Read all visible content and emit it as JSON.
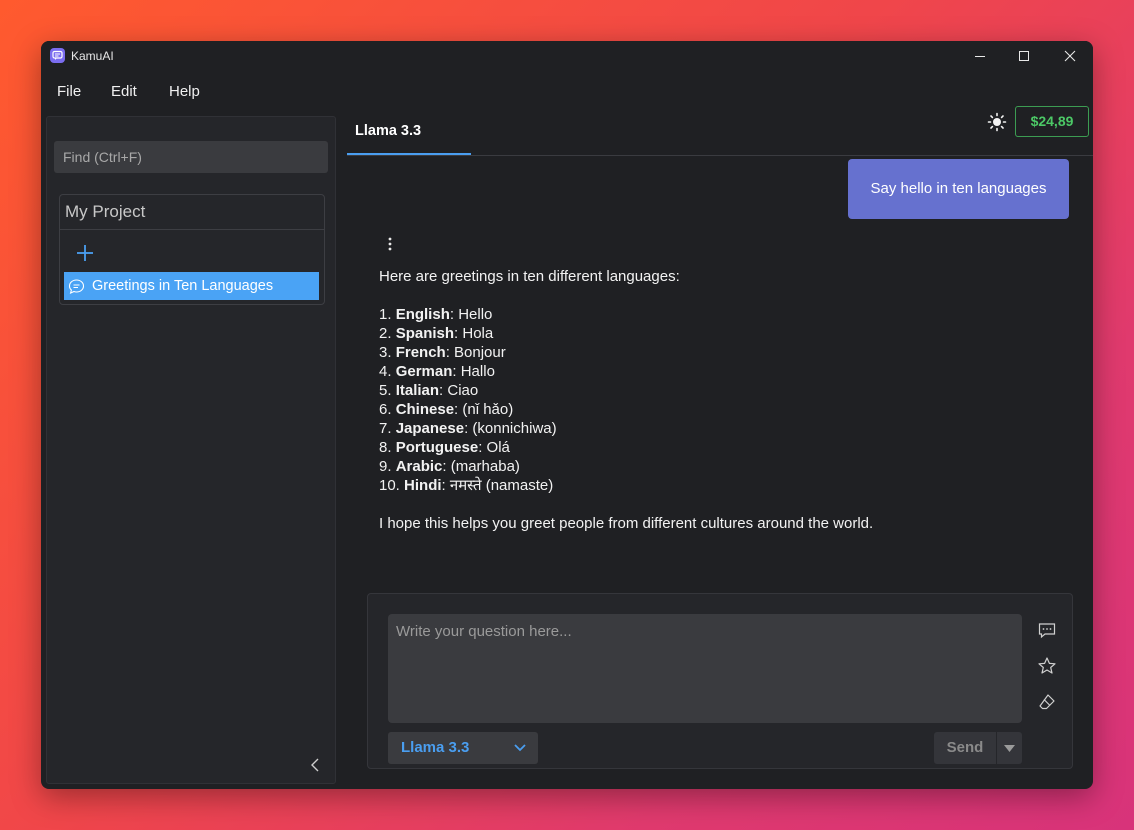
{
  "window": {
    "title": "KamuAI"
  },
  "menu": {
    "items": [
      "File",
      "Edit",
      "Help"
    ]
  },
  "header": {
    "balance": "$24,89",
    "balance_color": "#4cc866"
  },
  "sidebar": {
    "search_placeholder": "Find (Ctrl+F)",
    "project_title": "My Project",
    "chats": [
      {
        "label": "Greetings in Ten Languages",
        "selected": true
      }
    ]
  },
  "tabs": [
    {
      "label": "Llama 3.3",
      "active": true
    }
  ],
  "conversation": {
    "user_message": "Say hello in ten languages",
    "reply_intro": "Here are greetings in ten different languages:",
    "reply_items": [
      {
        "num": "1.",
        "lang": "English",
        "text": ": Hello"
      },
      {
        "num": "2.",
        "lang": "Spanish",
        "text": ": Hola"
      },
      {
        "num": "3.",
        "lang": "French",
        "text": ": Bonjour"
      },
      {
        "num": "4.",
        "lang": "German",
        "text": ": Hallo"
      },
      {
        "num": "5.",
        "lang": "Italian",
        "text": ": Ciao"
      },
      {
        "num": "6.",
        "lang": "Chinese",
        "text": ": (nǐ hǎo)"
      },
      {
        "num": "7.",
        "lang": "Japanese",
        "text": ": (konnichiwa)"
      },
      {
        "num": "8.",
        "lang": "Portuguese",
        "text": ": Olá"
      },
      {
        "num": "9.",
        "lang": "Arabic",
        "text": ": (marhaba)"
      },
      {
        "num": "10.",
        "lang": "Hindi",
        "text": ": नमस्ते (namaste)"
      }
    ],
    "reply_outro": "I hope this helps you greet people from different cultures around the world."
  },
  "composer": {
    "placeholder": "Write your question here...",
    "model": "Llama 3.3",
    "send_label": "Send"
  },
  "colors": {
    "accent": "#4a9ef0",
    "user_bubble": "#6671cf",
    "selected_chat": "#4aa3f5"
  }
}
